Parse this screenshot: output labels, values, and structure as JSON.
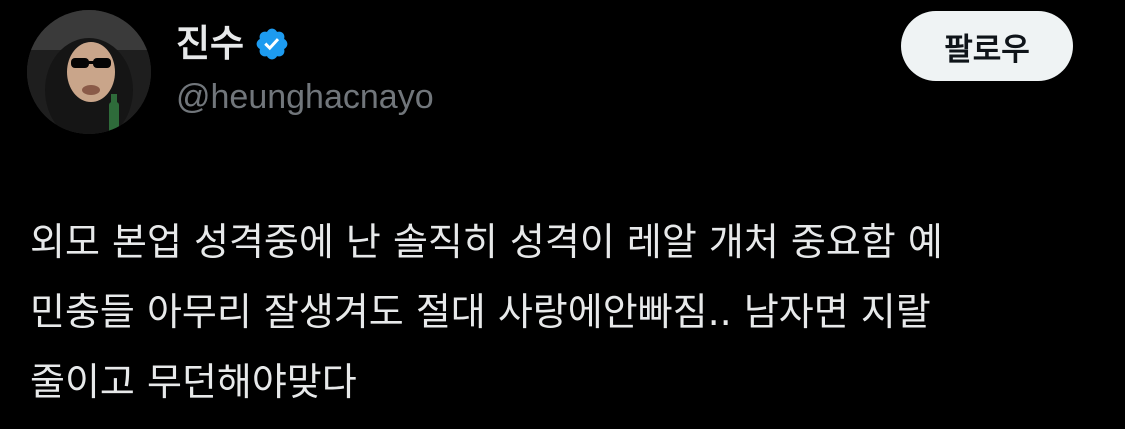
{
  "user": {
    "display_name": "진수",
    "handle": "@heunghacnayo",
    "verified": true,
    "avatar_icon": "avatar-image"
  },
  "follow_button": {
    "label": "팔로우"
  },
  "tweet": {
    "lines": [
      "외모 본업 성격중에 난 솔직히 성격이 레알 개처 중요함 예",
      "민충들 아무리 잘생겨도 절대 사랑에안빠짐.. 남자면 지랄",
      "줄이고 무던해야맞다"
    ]
  },
  "colors": {
    "background": "#000000",
    "text": "#e7e9ea",
    "secondary_text": "#71767b",
    "verified_badge": "#1d9bf0",
    "follow_button_bg": "#eff3f4",
    "follow_button_text": "#0f1419"
  }
}
